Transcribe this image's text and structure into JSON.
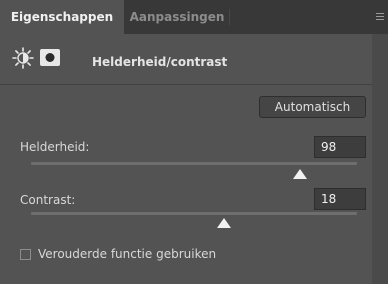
{
  "tabs": [
    {
      "label": "Eigenschappen",
      "active": true
    },
    {
      "label": "Aanpassingen",
      "active": false
    }
  ],
  "header": {
    "title": "Helderheid/contrast",
    "icons": [
      "brightness-contrast-icon",
      "layer-mask-icon"
    ]
  },
  "auto_button": {
    "label": "Automatisch"
  },
  "brightness": {
    "label": "Helderheid:",
    "value": "98"
  },
  "contrast": {
    "label": "Contrast:",
    "value": "18"
  },
  "legacy": {
    "label": "Verouderde functie gebruiken",
    "checked": false
  },
  "colors": {
    "panel_bg": "#535353",
    "tabbar_bg": "#383838",
    "text": "#d8d8d8"
  }
}
